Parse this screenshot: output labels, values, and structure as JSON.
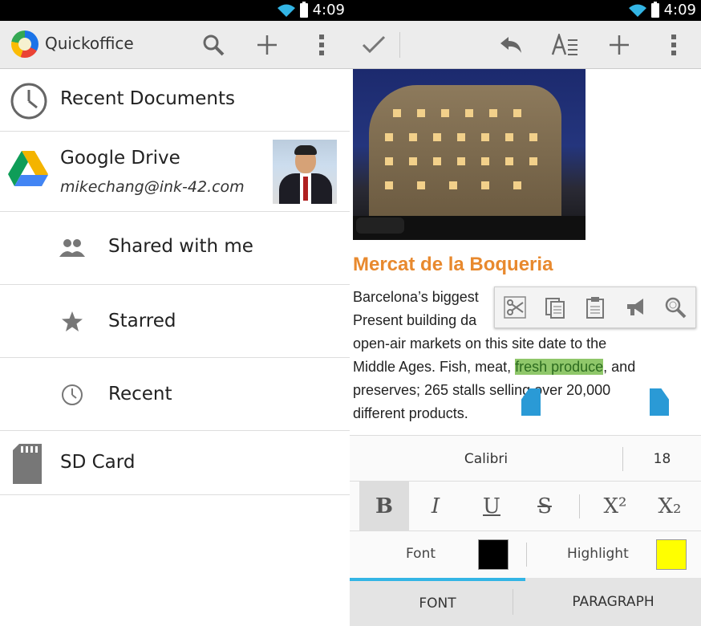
{
  "left": {
    "status_time": "4:09",
    "app_title": "Quickoffice",
    "items": {
      "recent_docs": "Recent Documents",
      "drive": "Google Drive",
      "drive_account": "mikechang@ink-42.com",
      "shared": "Shared with me",
      "starred": "Starred",
      "recent": "Recent",
      "sdcard": "SD Card"
    }
  },
  "right": {
    "status_time": "4:09",
    "doc": {
      "title": "Mercat de la Boqueria",
      "line1": "Barcelona’s biggest",
      "line2": "Present building da",
      "line3": "open-air markets on this site date to the",
      "line4_pre": "Middle Ages. Fish, meat, ",
      "line4_sel": "fresh produce",
      "line4_post": ", and",
      "line5": "preserves; 265 stalls selling over 20,000",
      "line6": "different products."
    },
    "format": {
      "font_name": "Calibri",
      "font_size": "18",
      "bold": "B",
      "italic": "I",
      "underline": "U",
      "strike": "S",
      "superscript": "X²",
      "subscript": "X₂",
      "font_color_label": "Font",
      "highlight_label": "Highlight",
      "font_color": "#000000",
      "highlight_color": "#ffff00"
    },
    "tabs": {
      "font": "FONT",
      "paragraph": "PARAGRAPH"
    }
  }
}
